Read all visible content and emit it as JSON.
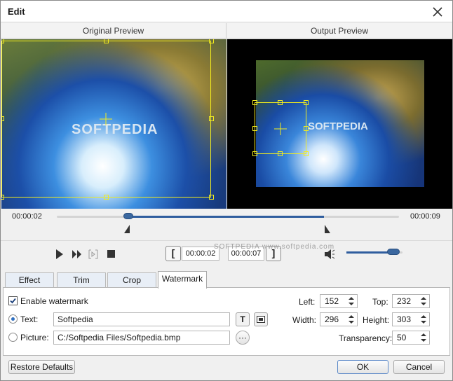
{
  "window": {
    "title": "Edit"
  },
  "preview": {
    "original_label": "Original Preview",
    "output_label": "Output Preview",
    "watermark_text": "SOFTPEDIA"
  },
  "timeline": {
    "start": "00:00:02",
    "end": "00:00:09",
    "start_fraction": 0.21,
    "end_fraction": 0.78
  },
  "playback": {
    "clip_start": "00:00:02",
    "clip_end": "00:00:07",
    "volume": 0.92
  },
  "tabs": [
    {
      "label": "Effect"
    },
    {
      "label": "Trim"
    },
    {
      "label": "Crop"
    },
    {
      "label": "Watermark",
      "active": true
    }
  ],
  "watermark": {
    "enable_label": "Enable watermark",
    "enabled": true,
    "text_label": "Text:",
    "text_value": "Softpedia",
    "picture_label": "Picture:",
    "picture_value": "C:/Softpedia Files/Softpedia.bmp",
    "browse_label": "···",
    "left_label": "Left:",
    "left_value": "152",
    "top_label": "Top:",
    "top_value": "232",
    "width_label": "Width:",
    "width_value": "296",
    "height_label": "Height:",
    "height_value": "303",
    "transparency_label": "Transparency:",
    "transparency_value": "50"
  },
  "buttons": {
    "restore": "Restore Defaults",
    "ok": "OK",
    "cancel": "Cancel"
  },
  "site_watermark": "SOFTPEDIA   www.softpedia.com",
  "colors": {
    "accent": "#2f5d9e",
    "handle": "#f2ec1e"
  }
}
